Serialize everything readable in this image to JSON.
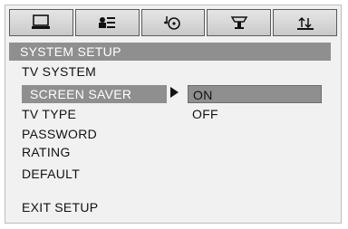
{
  "tabs": [
    {
      "icon": "monitor-icon"
    },
    {
      "icon": "person-card-icon"
    },
    {
      "icon": "music-disc-icon"
    },
    {
      "icon": "speaker-icon"
    },
    {
      "icon": "adjust-icon"
    }
  ],
  "menu": {
    "title": "SYSTEM SETUP",
    "items": [
      "TV SYSTEM",
      "SCREEN SAVER",
      "TV TYPE",
      "PASSWORD",
      "RATING",
      "DEFAULT",
      "EXIT SETUP"
    ],
    "selected": "SCREEN SAVER"
  },
  "submenu": {
    "options": [
      "ON",
      "OFF"
    ],
    "selected": "ON"
  },
  "colors": {
    "highlight": "#8f8f8f",
    "background": "#f1f1f1",
    "text": "#111111"
  }
}
